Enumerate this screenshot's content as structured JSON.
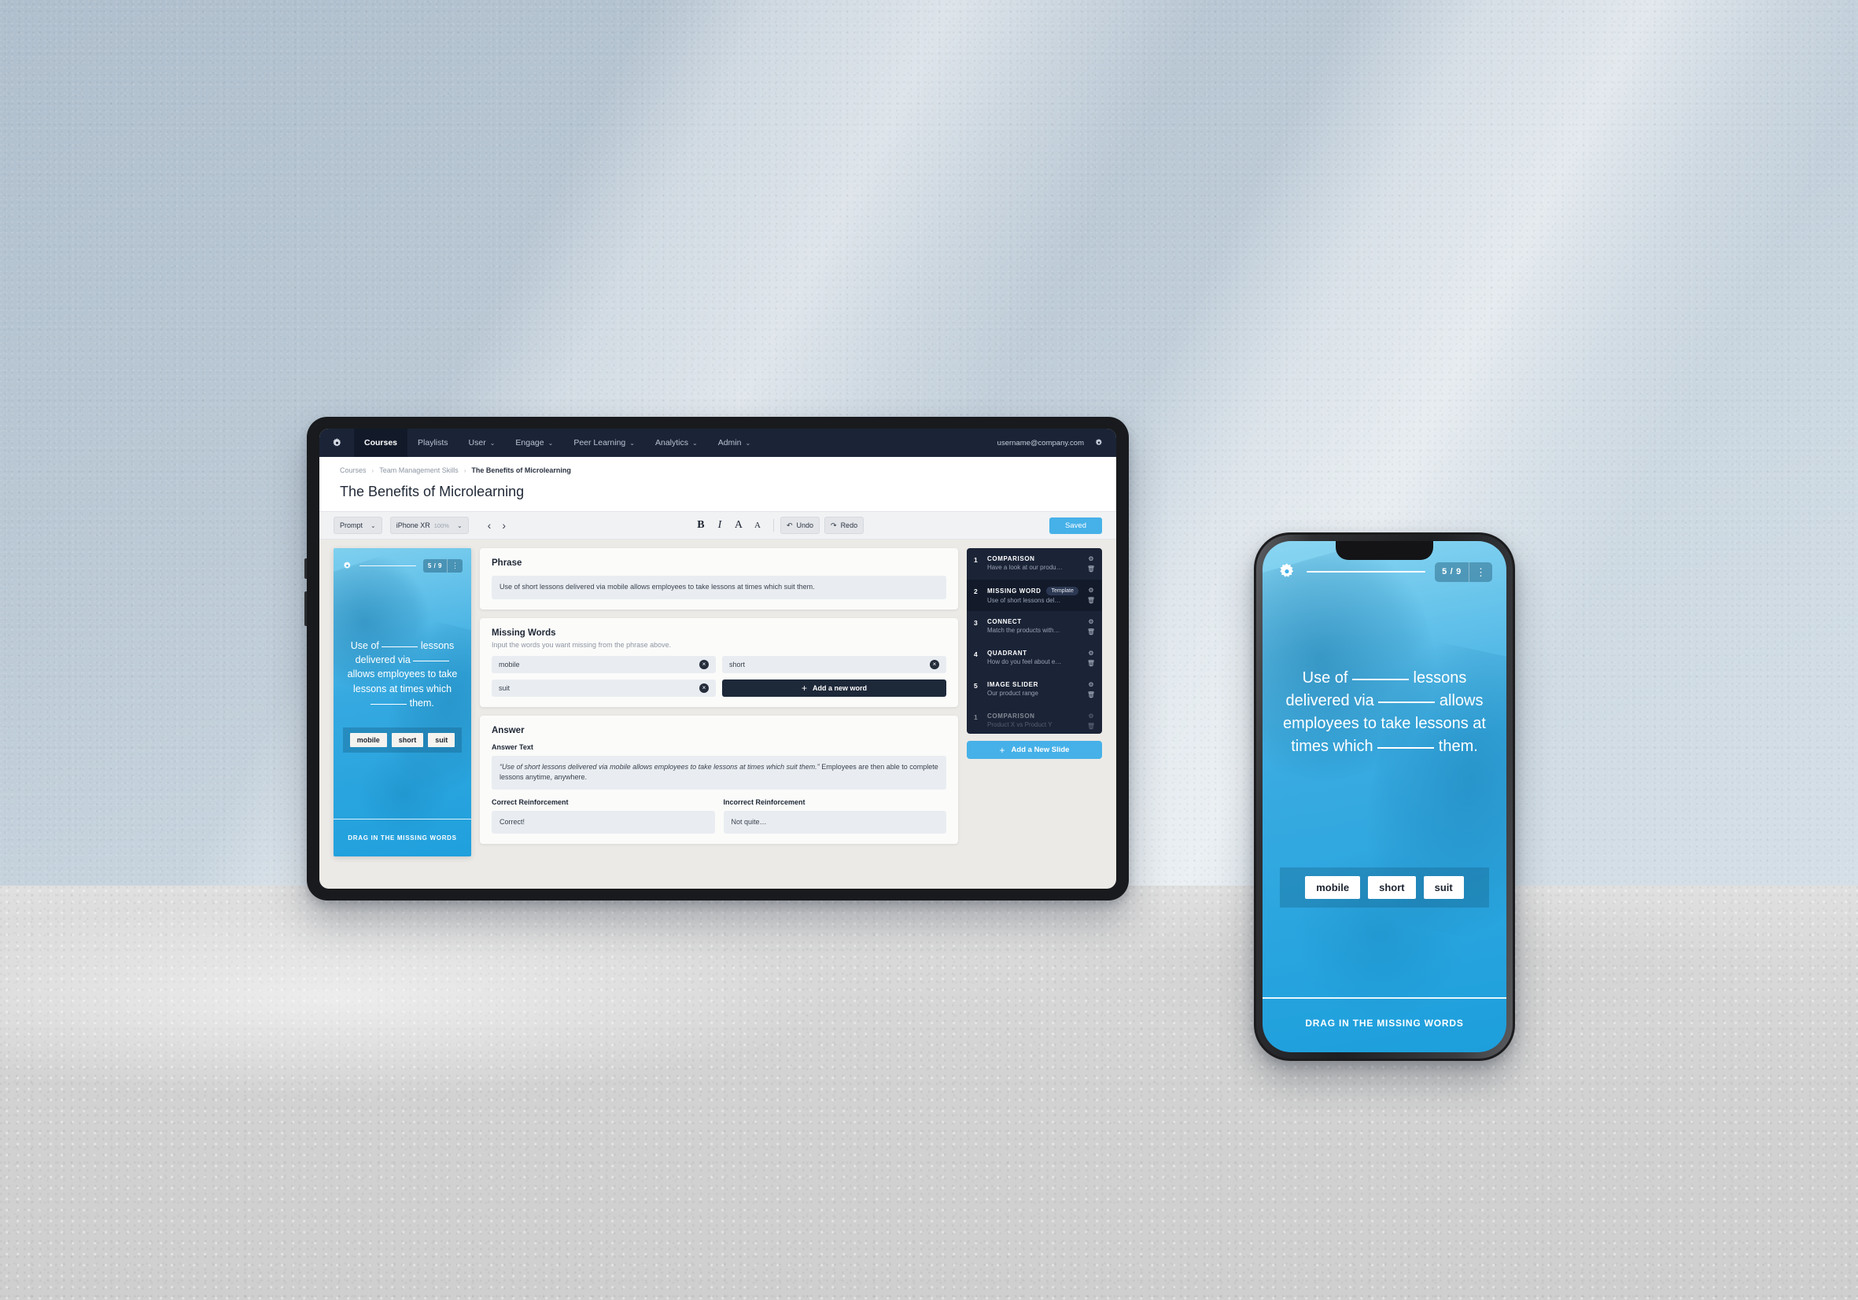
{
  "topnav": {
    "logo_icon": "gear-icon",
    "items": [
      {
        "label": "Courses",
        "caret": false,
        "active": true
      },
      {
        "label": "Playlists",
        "caret": false,
        "active": false
      },
      {
        "label": "User",
        "caret": true,
        "active": false
      },
      {
        "label": "Engage",
        "caret": true,
        "active": false
      },
      {
        "label": "Peer Learning",
        "caret": true,
        "active": false
      },
      {
        "label": "Analytics",
        "caret": true,
        "active": false
      },
      {
        "label": "Admin",
        "caret": true,
        "active": false
      }
    ],
    "user_email": "username@company.com",
    "settings_icon": "gear-icon",
    "caret_glyph": "⌄"
  },
  "breadcrumb": {
    "items": [
      "Courses",
      "Team Management Skills",
      "The Benefits of Microlearning"
    ],
    "separator": "›"
  },
  "page_title": "The Benefits of Microlearning",
  "toolbar": {
    "prompt_label": "Prompt",
    "prompt_caret": "⌄",
    "device_label": "iPhone XR",
    "device_zoom": "100%",
    "device_caret": "⌄",
    "prev_arrow": "‹",
    "next_arrow": "›",
    "bold": "B",
    "italic": "I",
    "font_large": "A",
    "font_small": "A",
    "undo_label": "Undo",
    "undo_icon": "↶",
    "redo_label": "Redo",
    "redo_icon": "↷",
    "saved_label": "Saved",
    "saved_color": "#46b1e8"
  },
  "preview": {
    "gear_icon": "gear-icon",
    "counter": "5 / 9",
    "menu_icon": "⋮",
    "text_parts": [
      "Use of ",
      " lessons delivered via ",
      " allows employees to take lessons at times which ",
      " them."
    ],
    "chips": [
      "mobile",
      "short",
      "suit"
    ],
    "footer": "DRAG IN THE MISSING WORDS"
  },
  "phrase_card": {
    "title": "Phrase",
    "value": "Use of short lessons delivered via mobile allows employees to take lessons at times which suit them."
  },
  "missing_words_card": {
    "title": "Missing Words",
    "subtitle": "Input the words you want missing from the phrase above.",
    "words": [
      "mobile",
      "short",
      "suit"
    ],
    "clear_icon": "×",
    "add_word_label": "Add a new word",
    "add_icon": "+"
  },
  "answer_card": {
    "title": "Answer",
    "answer_text_label": "Answer Text",
    "answer_quote": "“Use of short lessons delivered via mobile allows employees to take lessons at times which suit them.”",
    "answer_rest": " Employees are then able to complete lessons anytime, anywhere.",
    "correct_label": "Correct Reinforcement",
    "correct_value": "Correct!",
    "incorrect_label": "Incorrect Reinforcement",
    "incorrect_value": "Not quite…"
  },
  "slide_list": {
    "gear_icon": "⚙",
    "trash_icon": "🗑",
    "template_badge": "Template",
    "slides": [
      {
        "num": "1",
        "type": "COMPARISON",
        "desc": "Have a look at our produ…",
        "active": false,
        "template": false
      },
      {
        "num": "2",
        "type": "MISSING WORD",
        "desc": "Use of short lessons del…",
        "active": true,
        "template": true
      },
      {
        "num": "3",
        "type": "CONNECT",
        "desc": "Match the products with…",
        "active": false,
        "template": false
      },
      {
        "num": "4",
        "type": "QUADRANT",
        "desc": "How do you feel about e…",
        "active": false,
        "template": false
      },
      {
        "num": "5",
        "type": "IMAGE SLIDER",
        "desc": "Our product range",
        "active": false,
        "template": false
      },
      {
        "num": "1",
        "type": "COMPARISON",
        "desc": "Product X vs Product Y",
        "active": false,
        "template": false
      }
    ],
    "add_slide_label": "Add a New Slide",
    "add_slide_icon": "+",
    "add_slide_color": "#46b1e8"
  },
  "phone": {
    "gear_icon": "gear-icon",
    "counter": "5 / 9",
    "menu_icon": "⋮",
    "text_parts": [
      "Use of ",
      " lessons delivered via ",
      " allows employees to take lessons at times which ",
      " them."
    ],
    "chips": [
      "mobile",
      "short",
      "suit"
    ],
    "footer": "DRAG IN THE MISSING WORDS"
  }
}
